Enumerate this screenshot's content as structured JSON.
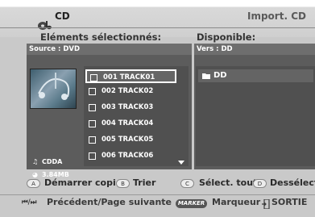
{
  "header": {
    "title": "CD",
    "import_label": "Import. CD",
    "selected_label": "Eléments sélectionnés:",
    "available_label": "Disponible:"
  },
  "source": {
    "label": "Source : DVD",
    "type": "CDDA",
    "size": "3.84MB"
  },
  "tracks": [
    {
      "label": "001  TRACK01",
      "selected": true
    },
    {
      "label": "002  TRACK02",
      "selected": false
    },
    {
      "label": "003  TRACK03",
      "selected": false
    },
    {
      "label": "004  TRACK04",
      "selected": false
    },
    {
      "label": "005  TRACK05",
      "selected": false
    },
    {
      "label": "006  TRACK06",
      "selected": false
    }
  ],
  "destination": {
    "label": "Vers : DD",
    "item": "DD"
  },
  "footer": {
    "a_key": "A",
    "a_label": "Démarrer copie",
    "b_key": "B",
    "b_label": "Trier",
    "c_key": "C",
    "c_label": "Sélect. tout",
    "d_key": "D",
    "d_label": "Dessélect. t",
    "prev_next_icon": "⏮/⏭",
    "prev_next_label": "Précédent/Page suivante",
    "marker_key": "MARKER",
    "marker_label": "Marqueur",
    "exit_label": "SORTIE"
  },
  "colors": {
    "panel_bg": "#5c5c5c",
    "background": "#cfcfcf",
    "text_dark": "#2a2a2a"
  }
}
